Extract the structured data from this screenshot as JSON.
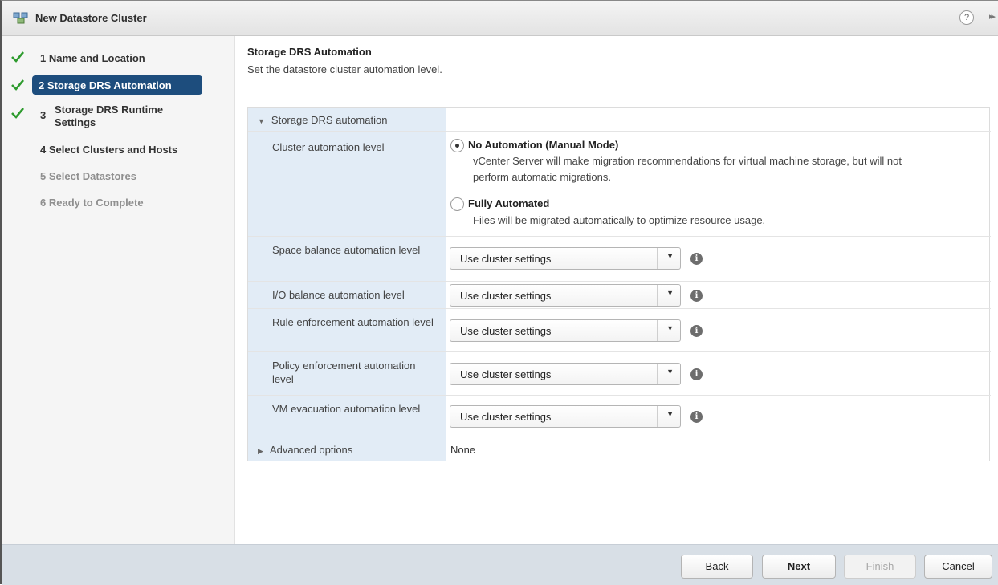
{
  "window": {
    "title": "New Datastore Cluster",
    "help_glyph": "?",
    "expand_glyph": "▸▸"
  },
  "sidebar": {
    "steps": [
      {
        "label": "1 Name and Location",
        "state": "done"
      },
      {
        "label": "2 Storage DRS Automation",
        "state": "active"
      },
      {
        "number": "3",
        "label_line1": "Storage DRS Runtime",
        "label_line2": "Settings",
        "state": "done"
      },
      {
        "label": "4 Select Clusters and Hosts",
        "state": "pending"
      },
      {
        "label": "5 Select Datastores",
        "state": "disabled"
      },
      {
        "label": "6 Ready to Complete",
        "state": "disabled"
      }
    ]
  },
  "main": {
    "title": "Storage DRS Automation",
    "subtitle": "Set the datastore cluster automation level.",
    "section_label": "Storage DRS automation",
    "cluster_automation": {
      "label": "Cluster automation level",
      "options": [
        {
          "title": "No Automation (Manual Mode)",
          "desc_line1": "vCenter Server will make migration recommendations for virtual machine storage, but will not",
          "desc_line2": "perform automatic migrations.",
          "selected": true
        },
        {
          "title": "Fully Automated",
          "desc_line1": "Files will be migrated automatically to optimize resource usage.",
          "selected": false
        }
      ]
    },
    "settings": [
      {
        "label": "Space balance automation level",
        "value": "Use cluster settings"
      },
      {
        "label": "I/O balance automation level",
        "value": "Use cluster settings"
      },
      {
        "label": "Rule enforcement automation level",
        "value": "Use cluster settings"
      },
      {
        "label": "Policy enforcement automation level",
        "value": "Use cluster settings"
      },
      {
        "label": "VM evacuation automation level",
        "value": "Use cluster settings"
      }
    ],
    "advanced": {
      "label": "Advanced options",
      "value": "None"
    }
  },
  "footer": {
    "back": "Back",
    "next": "Next",
    "finish": "Finish",
    "cancel": "Cancel"
  },
  "colors": {
    "active_step": "#1d4d7d",
    "check_green": "#2e9b2e",
    "label_column": "#e2ecf6",
    "footer_bg": "#d8dfe6"
  }
}
